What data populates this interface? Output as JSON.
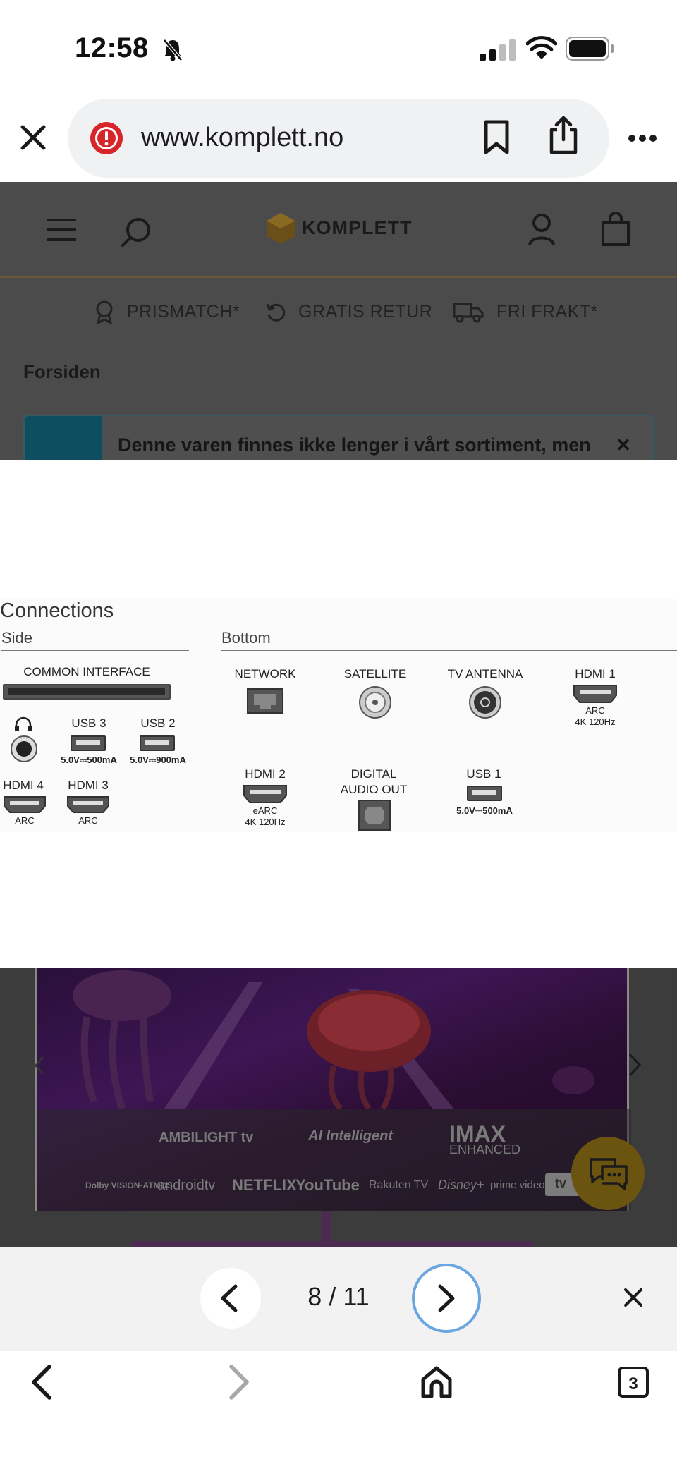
{
  "status_bar": {
    "time": "12:58"
  },
  "browser": {
    "url": "www.komplett.no"
  },
  "site": {
    "logo": "KOMPLETT",
    "usps": [
      "PRISMATCH*",
      "GRATIS RETUR",
      "FRI FRAKT*"
    ],
    "breadcrumb": "Forsiden",
    "notice": "Denne varen finnes ikke lenger i vårt sortiment, men"
  },
  "connections": {
    "title": "Connections",
    "side_label": "Side",
    "bottom_label": "Bottom",
    "common_interface": "COMMON INTERFACE",
    "usb3": "USB 3",
    "usb3_spec": "5.0V⎓500mA",
    "usb2": "USB 2",
    "usb2_spec": "5.0V⎓900mA",
    "hdmi4": "HDMI 4",
    "hdmi4_sub": "ARC",
    "hdmi3": "HDMI 3",
    "hdmi3_sub": "ARC",
    "network": "NETWORK",
    "satellite": "SATELLITE",
    "tv_antenna": "TV ANTENNA",
    "hdmi1": "HDMI 1",
    "hdmi1_sub1": "ARC",
    "hdmi1_sub2": "4K 120Hz",
    "hdmi2": "HDMI 2",
    "hdmi2_sub1": "eARC",
    "hdmi2_sub2": "4K 120Hz",
    "digital_audio_1": "DIGITAL",
    "digital_audio_2": "AUDIO OUT",
    "usb1": "USB 1",
    "usb1_spec": "5.0V⎓500mA"
  },
  "tv_image": {
    "ambilight": "AMBILIGHT tv",
    "ai": "AI Intelligent",
    "imax1": "IMAX",
    "imax2": "ENHANCED",
    "dolby": "Dolby VISION·ATMOS",
    "androidtv": "androidtv",
    "netflix": "NETFLIX",
    "youtube": "YouTube",
    "rakuten": "Rakuten TV",
    "disney": "Disney+",
    "prime": "prime video",
    "appletv": "tv"
  },
  "pager": {
    "count": "8 / 11"
  },
  "toolbar": {
    "tabs_count": "3"
  }
}
